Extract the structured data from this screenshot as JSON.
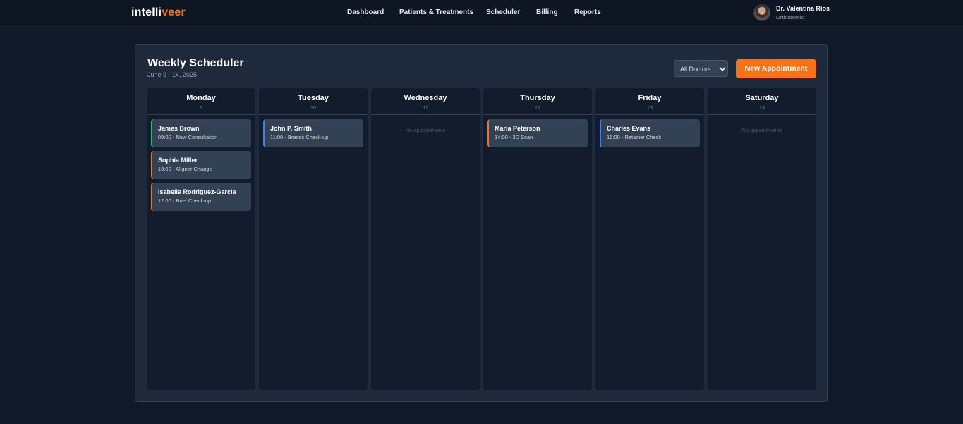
{
  "brand": {
    "part1": "intelli",
    "part2": "veer",
    "accent": "#f97316"
  },
  "nav": {
    "items": [
      {
        "label": "Dashboard"
      },
      {
        "label": "Patients & Treatments"
      },
      {
        "label": "Scheduler"
      },
      {
        "label": "Billing"
      },
      {
        "label": "Reports"
      }
    ]
  },
  "user": {
    "name": "Dr. Valentina Rios",
    "role": "Orthodontist"
  },
  "scheduler": {
    "title": "Weekly Scheduler",
    "date_range": "June 9 - 14, 2025",
    "doctor_filter": {
      "selected": "All Doctors",
      "icon": "chevron-down-icon"
    },
    "new_button": "New Appointment",
    "empty_text": "No appointments",
    "days": [
      {
        "name": "Monday",
        "date": "9",
        "appointments": [
          {
            "patient": "James Brown",
            "time": "09:00",
            "type": "New Consultation",
            "color": "#22c55e"
          },
          {
            "patient": "Sophia Miller",
            "time": "10:00",
            "type": "Aligner Change",
            "color": "#f97316"
          },
          {
            "patient": "Isabella Rodriguez-Garcia",
            "time": "12:00",
            "type": "Brief Check-up",
            "color": "#f97316"
          }
        ]
      },
      {
        "name": "Tuesday",
        "date": "10",
        "appointments": [
          {
            "patient": "John P. Smith",
            "time": "11:00",
            "type": "Braces Check-up",
            "color": "#3b82f6"
          }
        ]
      },
      {
        "name": "Wednesday",
        "date": "11",
        "appointments": []
      },
      {
        "name": "Thursday",
        "date": "12",
        "appointments": [
          {
            "patient": "Maria Peterson",
            "time": "14:00",
            "type": "3D Scan",
            "color": "#f97316"
          }
        ]
      },
      {
        "name": "Friday",
        "date": "13",
        "appointments": [
          {
            "patient": "Charles Evans",
            "time": "16:00",
            "type": "Retainer Check",
            "color": "#3b82f6"
          }
        ]
      },
      {
        "name": "Saturday",
        "date": "14",
        "appointments": []
      }
    ]
  }
}
